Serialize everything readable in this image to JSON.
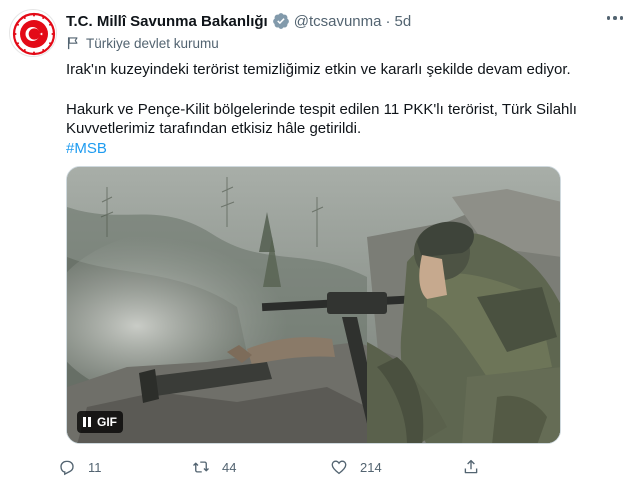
{
  "account": {
    "name": "T.C. Millî Savunma Bakanlığı",
    "handle": "@tcsavunma",
    "separator": "·",
    "time": "5d",
    "label": "Türkiye devlet kurumu"
  },
  "tweet": {
    "line1": "Irak'ın kuzeyindeki terörist temizliğimiz etkin ve kararlı şekilde devam ediyor.",
    "line2": "Hakurk ve Pençe-Kilit bölgelerinde tespit edilen 11 PKK'lı terörist, Türk Silahlı Kuvvetlerimiz tarafından etkisiz hâle getirildi.",
    "hashtag": "#MSB"
  },
  "media": {
    "badge": "GIF"
  },
  "actions": {
    "replies": "11",
    "retweets": "44",
    "likes": "214"
  },
  "colors": {
    "accent": "#1d9bf0",
    "secondary_text": "#536471",
    "emblem_red": "#e30a17"
  },
  "icons": [
    "verified-badge-icon",
    "more-icon",
    "government-flag-icon",
    "pause-icon",
    "reply-icon",
    "retweet-icon",
    "like-icon",
    "share-icon"
  ]
}
